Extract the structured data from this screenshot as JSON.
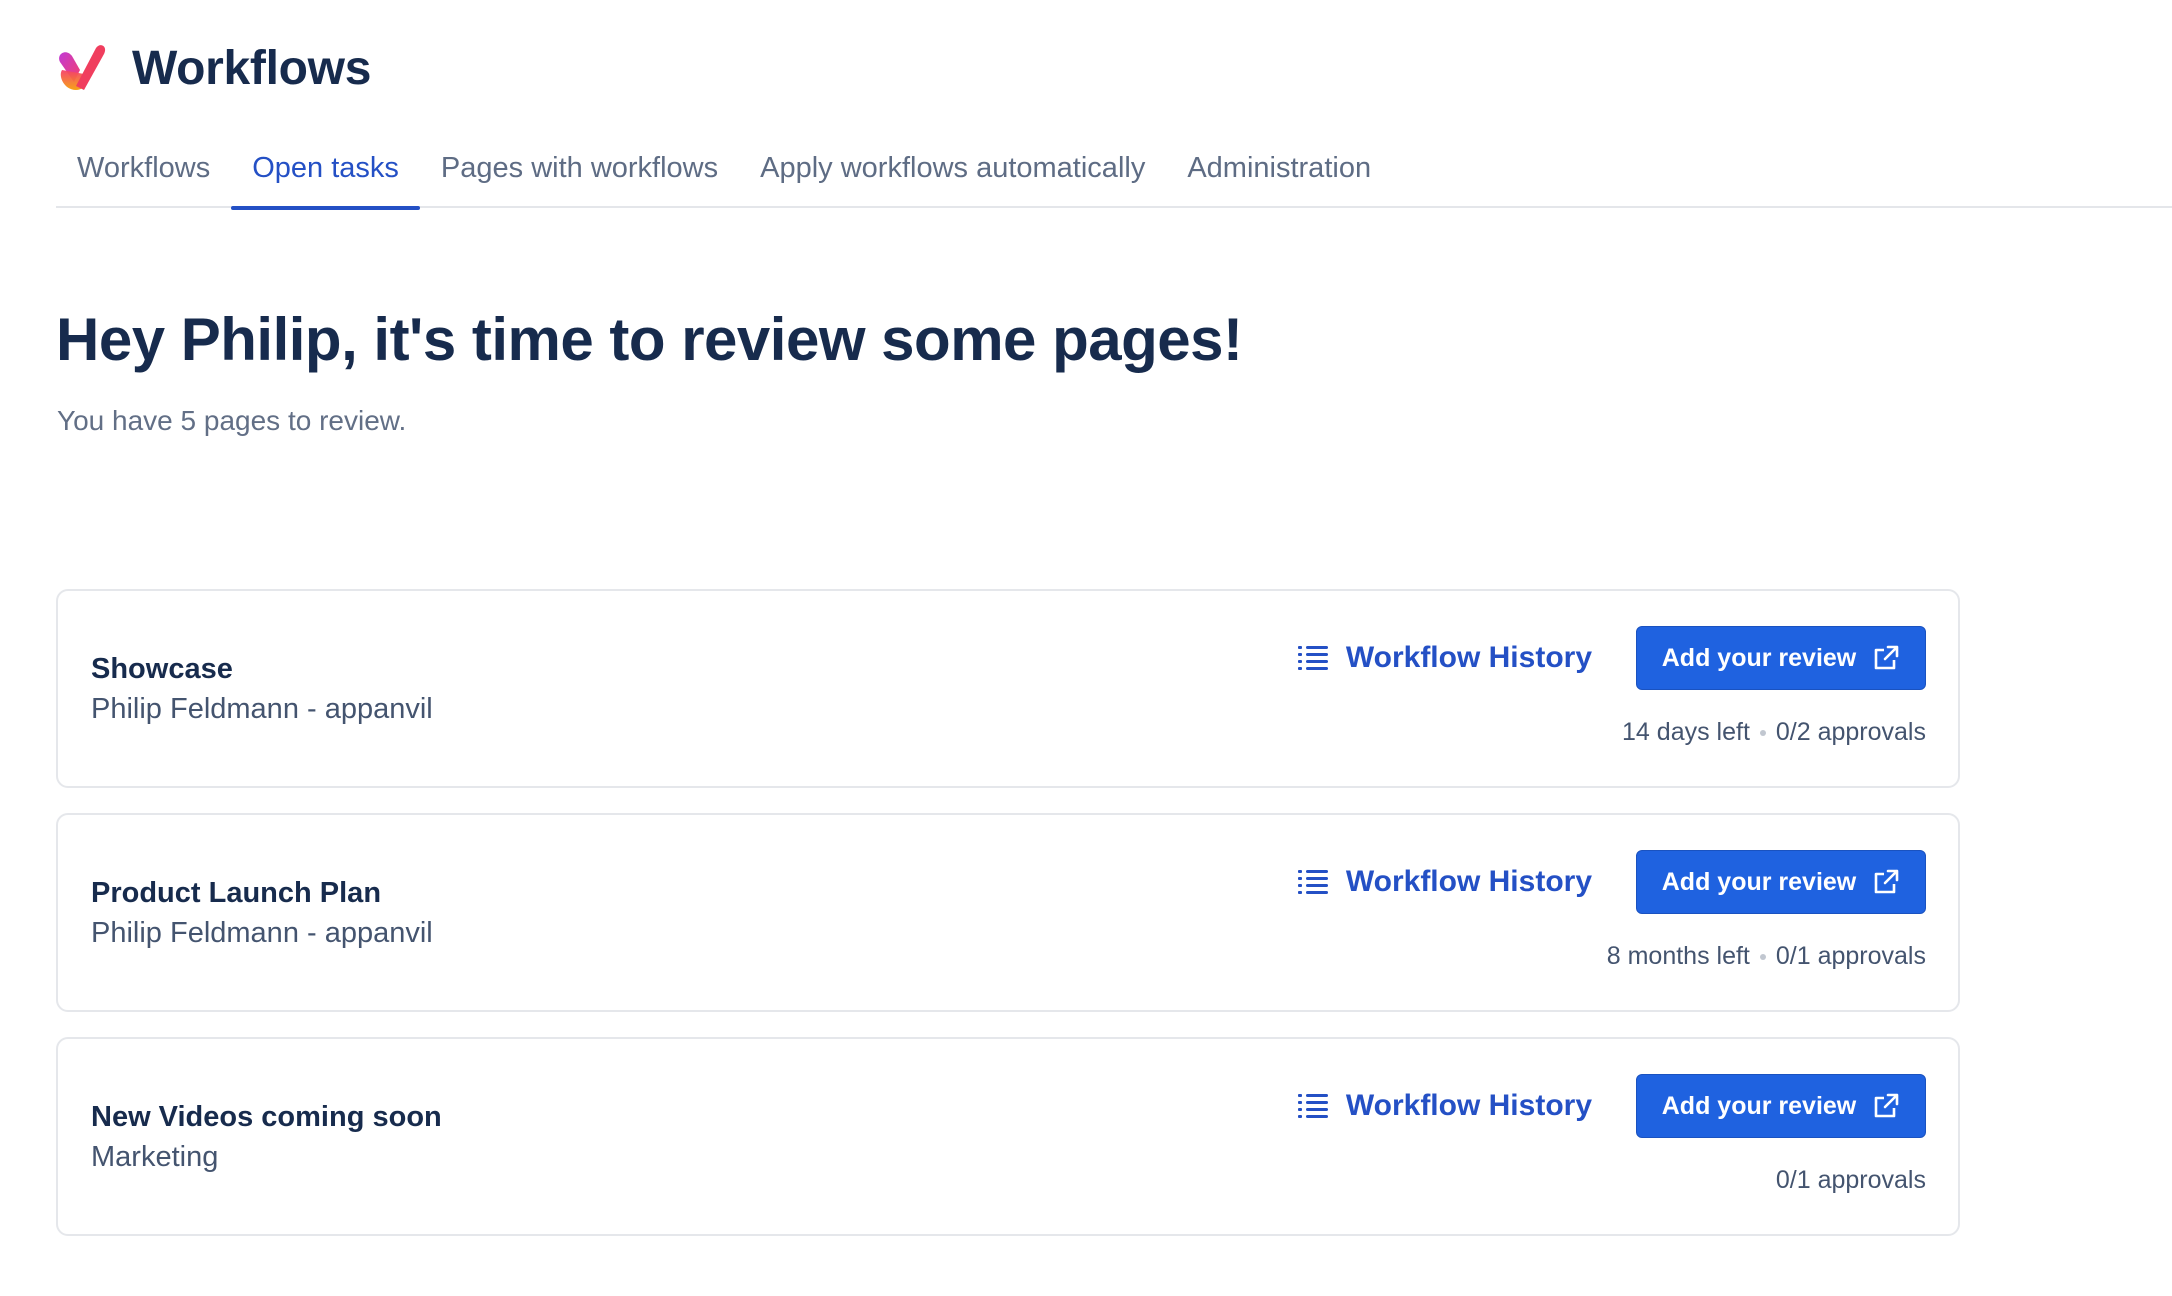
{
  "app": {
    "title": "Workflows",
    "logo_icon": "heart-check-logo-icon",
    "logo_colors": [
      "#f5406b",
      "#a63ed3",
      "#f59e0b"
    ]
  },
  "tabs": [
    {
      "label": "Workflows",
      "active": false
    },
    {
      "label": "Open tasks",
      "active": true
    },
    {
      "label": "Pages with workflows",
      "active": false
    },
    {
      "label": "Apply workflows automatically",
      "active": false
    },
    {
      "label": "Administration",
      "active": false
    }
  ],
  "main": {
    "greeting": "Hey Philip, it's time to review some pages!",
    "subtitle": "You have 5 pages to review."
  },
  "cards": [
    {
      "title": "Showcase",
      "meta": "Philip Feldmann - appanvil",
      "history_label": "Workflow History",
      "review_label": "Add your review",
      "time_left": "14 days left",
      "approvals": "0/2 approvals"
    },
    {
      "title": "Product Launch Plan",
      "meta": "Philip Feldmann - appanvil",
      "history_label": "Workflow History",
      "review_label": "Add your review",
      "time_left": "8 months left",
      "approvals": "0/1 approvals"
    },
    {
      "title": "New Videos coming soon",
      "meta": "Marketing",
      "history_label": "Workflow History",
      "review_label": "Add your review",
      "time_left": "",
      "approvals": "0/1 approvals"
    }
  ],
  "colors": {
    "accent": "#2450c5",
    "button": "#1f62e0",
    "text": "#172b4d",
    "muted": "#626f86"
  },
  "icons": {
    "history": "list-icon",
    "review": "external-link-icon"
  }
}
